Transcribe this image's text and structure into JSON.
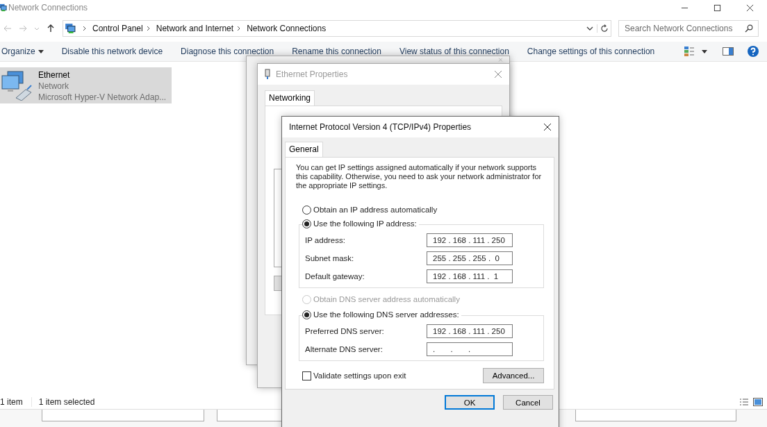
{
  "window": {
    "title": "Network Connections"
  },
  "address_bar": {
    "path": [
      "Control Panel",
      "Network and Internet",
      "Network Connections"
    ]
  },
  "search": {
    "placeholder": "Search Network Connections"
  },
  "toolbar": {
    "organize": "Organize",
    "commands": [
      "Disable this network device",
      "Diagnose this connection",
      "Rename this connection",
      "View status of this connection",
      "Change settings of this connection"
    ]
  },
  "connections": [
    {
      "name": "Ethernet",
      "status": "Network",
      "adapter": "Microsoft Hyper-V Network Adap...",
      "selected": true
    }
  ],
  "status_bar": {
    "count": "1 item",
    "selection": "1 item selected"
  },
  "properties_dialog": {
    "title": "Ethernet Properties",
    "tabs": [
      {
        "label": "Networking",
        "selected": true
      }
    ]
  },
  "ipv4_dialog": {
    "title": "Internet Protocol Version 4 (TCP/IPv4) Properties",
    "tabs": [
      {
        "label": "General",
        "selected": true
      }
    ],
    "intro": "You can get IP settings assigned automatically if your network supports this capability. Otherwise, you need to ask your network administrator for the appropriate IP settings.",
    "ip_options": [
      {
        "label": "Obtain an IP address automatically",
        "selected": false,
        "disabled": false
      },
      {
        "label": "Use the following IP address:",
        "selected": true,
        "disabled": false
      }
    ],
    "ip_fields": [
      {
        "label": "IP address:",
        "value": "192 . 168 . 111 . 250"
      },
      {
        "label": "Subnet mask:",
        "value": "255 . 255 . 255 .  0"
      },
      {
        "label": "Default gateway:",
        "value": "192 . 168 . 111 .  1"
      }
    ],
    "dns_options": [
      {
        "label": "Obtain DNS server address automatically",
        "selected": false,
        "disabled": true
      },
      {
        "label": "Use the following DNS server addresses:",
        "selected": true,
        "disabled": false
      }
    ],
    "dns_fields": [
      {
        "label": "Preferred DNS server:",
        "value": "192 . 168 . 111 . 250"
      },
      {
        "label": "Alternate DNS server:",
        "value": ".       .       ."
      }
    ],
    "validate": {
      "label": "Validate settings upon exit",
      "checked": false
    },
    "advanced": "Advanced...",
    "buttons": [
      {
        "label": "OK",
        "kind": "default"
      },
      {
        "label": "Cancel",
        "kind": "normal"
      }
    ]
  }
}
